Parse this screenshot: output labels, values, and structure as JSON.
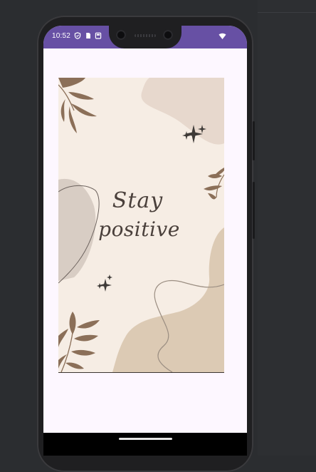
{
  "status_bar": {
    "time": "10:52",
    "background": "#6750a4",
    "icons": [
      "shield-icon",
      "sim-card-icon",
      "storage-icon",
      "wifi-icon"
    ]
  },
  "poster": {
    "line1": "Stay",
    "line2": "positive",
    "background": "#f6ede4",
    "colors": {
      "leaf": "#8b6f58",
      "blob_light": "#e7d8cd",
      "blob_tan": "#dccab4",
      "blob_grey": "#d8cdc4",
      "sparkle": "#3e3a37",
      "text": "#4a403b"
    },
    "decorations": [
      "leaf-branch-icon",
      "sparkle-icon",
      "organic-blob",
      "wavy-line"
    ]
  },
  "app": {
    "background": "#fdf7ff"
  },
  "navigation": {
    "home_indicator": "home-gesture-pill"
  }
}
